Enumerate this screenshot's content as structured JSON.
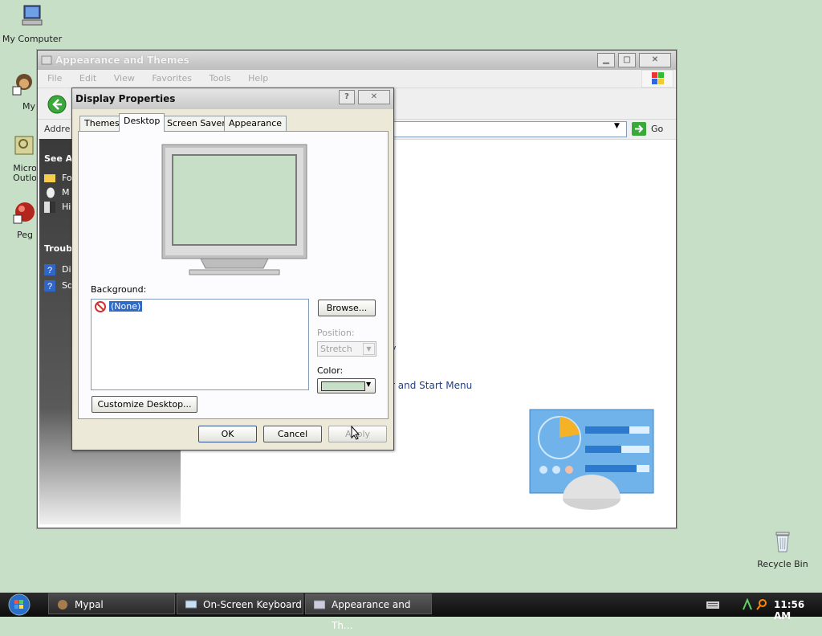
{
  "desktop": {
    "icons": [
      {
        "label": "My Computer",
        "icon": "my-computer-icon"
      },
      {
        "label": "MyPal",
        "icon": "mypal-icon"
      },
      {
        "label": "Micro Outlo",
        "icon": "outlook-icon"
      },
      {
        "label": "Peg",
        "icon": "peg-icon"
      },
      {
        "label": "Recycle Bin",
        "icon": "recycle-bin-icon"
      }
    ]
  },
  "appwin": {
    "title": "Appearance and Themes",
    "menu": [
      "File",
      "Edit",
      "View",
      "Favorites",
      "Tools",
      "Help"
    ],
    "address_label": "Addre",
    "go_label": "Go",
    "left_pane": {
      "see_also": "See Al",
      "items": [
        "Fo",
        "M",
        "Hi"
      ],
      "troubleshooters": "Troubl",
      "ts_items": [
        "Di",
        "So"
      ]
    },
    "links": {
      "link1": "y",
      "link2": "r and Start Menu"
    }
  },
  "dialog": {
    "title": "Display Properties",
    "tabs": [
      "Themes",
      "Desktop",
      "Screen Saver",
      "Appearance"
    ],
    "active_tab": "Desktop",
    "background_label": "Background:",
    "background_items": [
      "(None)"
    ],
    "browse_button": "Browse...",
    "position_label": "Position:",
    "position_value": "Stretch",
    "color_label": "Color:",
    "color_value": "#c7dfc6",
    "customize_button": "Customize Desktop...",
    "ok_button": "OK",
    "cancel_button": "Cancel",
    "apply_button": "Apply"
  },
  "taskbar": {
    "tasks": [
      "Mypal",
      "On-Screen Keyboard",
      "Appearance and Th..."
    ],
    "clock": "11:56 AM"
  },
  "colors": {
    "desktop": "#c7dfc6",
    "dialog_bg": "#ece9d8",
    "taskbar": "#1a1a1a"
  }
}
